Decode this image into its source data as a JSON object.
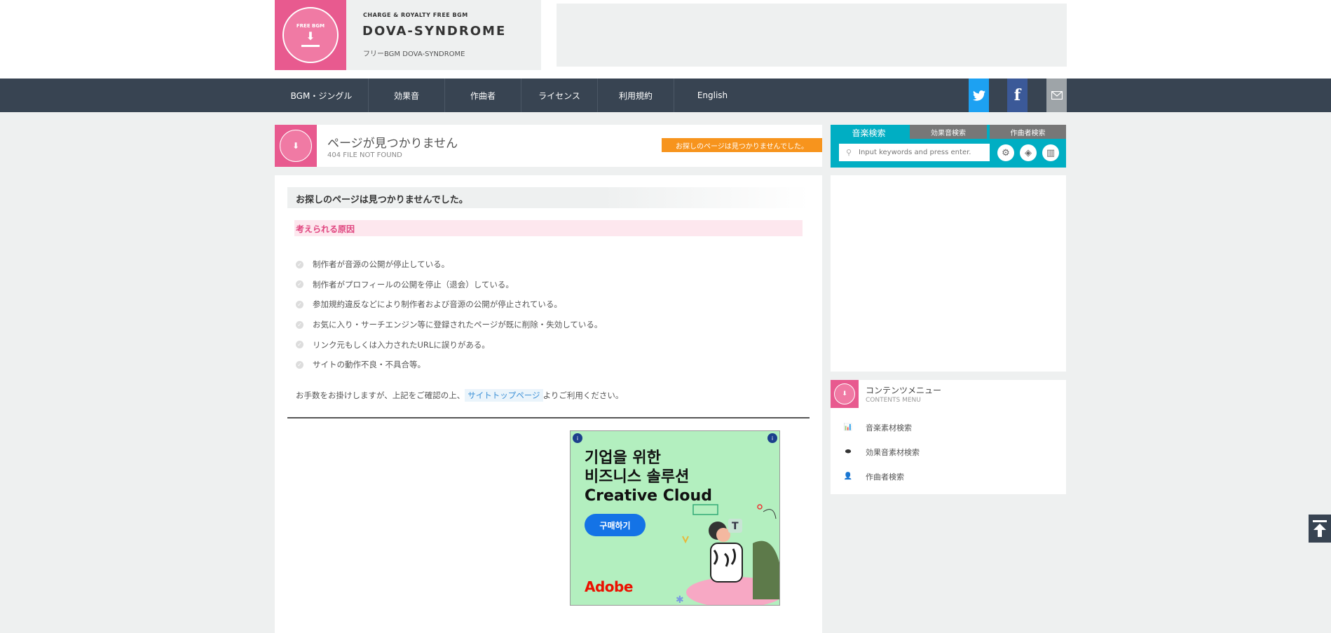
{
  "header": {
    "tagline": "CHARGE & ROYALTY FREE BGM",
    "title": "DOVA-SYNDROME",
    "subtitle": "フリーBGM DOVA-SYNDROME",
    "logo_text": "FREE BGM"
  },
  "nav": {
    "items": [
      "BGM・ジングル",
      "効果音",
      "作曲者",
      "ライセンス",
      "利用規約",
      "English"
    ],
    "social": {
      "twitter": "twitter-icon",
      "facebook": "facebook-icon",
      "mail": "mail-icon"
    }
  },
  "page": {
    "title": "ページが見つかりません",
    "subtitle": "404 FILE NOT FOUND",
    "badge": "お探しのページは見つかりませんでした。"
  },
  "content": {
    "heading": "お探しのページは見つかりませんでした。",
    "cause_heading": "考えられる原因",
    "reasons": [
      "制作者が音源の公開が停止している。",
      "制作者がプロフィールの公開を停止（退会）している。",
      "参加規約違反などにより制作者および音源の公開が停止されている。",
      "お気に入り・サーチエンジン等に登録されたページが既に削除・失効している。",
      "リンク元もしくは入力されたURLに誤りがある。",
      "サイトの動作不良・不具合等。"
    ],
    "note_before": "お手数をお掛けしますが、上記をご確認の上、",
    "note_link": "サイトトップページ",
    "note_after": "よりご利用ください。"
  },
  "ad": {
    "headline_line1": "기업을 위한",
    "headline_line2": "비즈니스 솔루션",
    "headline_line3": "Creative Cloud",
    "cta": "구매하기",
    "brand": "Adobe"
  },
  "search": {
    "tabs": [
      "音楽検索",
      "効果音検索",
      "作曲者検索"
    ],
    "placeholder": "Input keywords and press enter."
  },
  "menu": {
    "title": "コンテンツメニュー",
    "subtitle": "CONTENTS MENU",
    "items": [
      "音楽素材検索",
      "効果音素材検索",
      "作曲者検索"
    ]
  },
  "colors": {
    "brand_pink": "#e85a8f",
    "nav_bg": "#384452",
    "accent_teal": "#00aec3",
    "badge_orange": "#f7941d"
  }
}
